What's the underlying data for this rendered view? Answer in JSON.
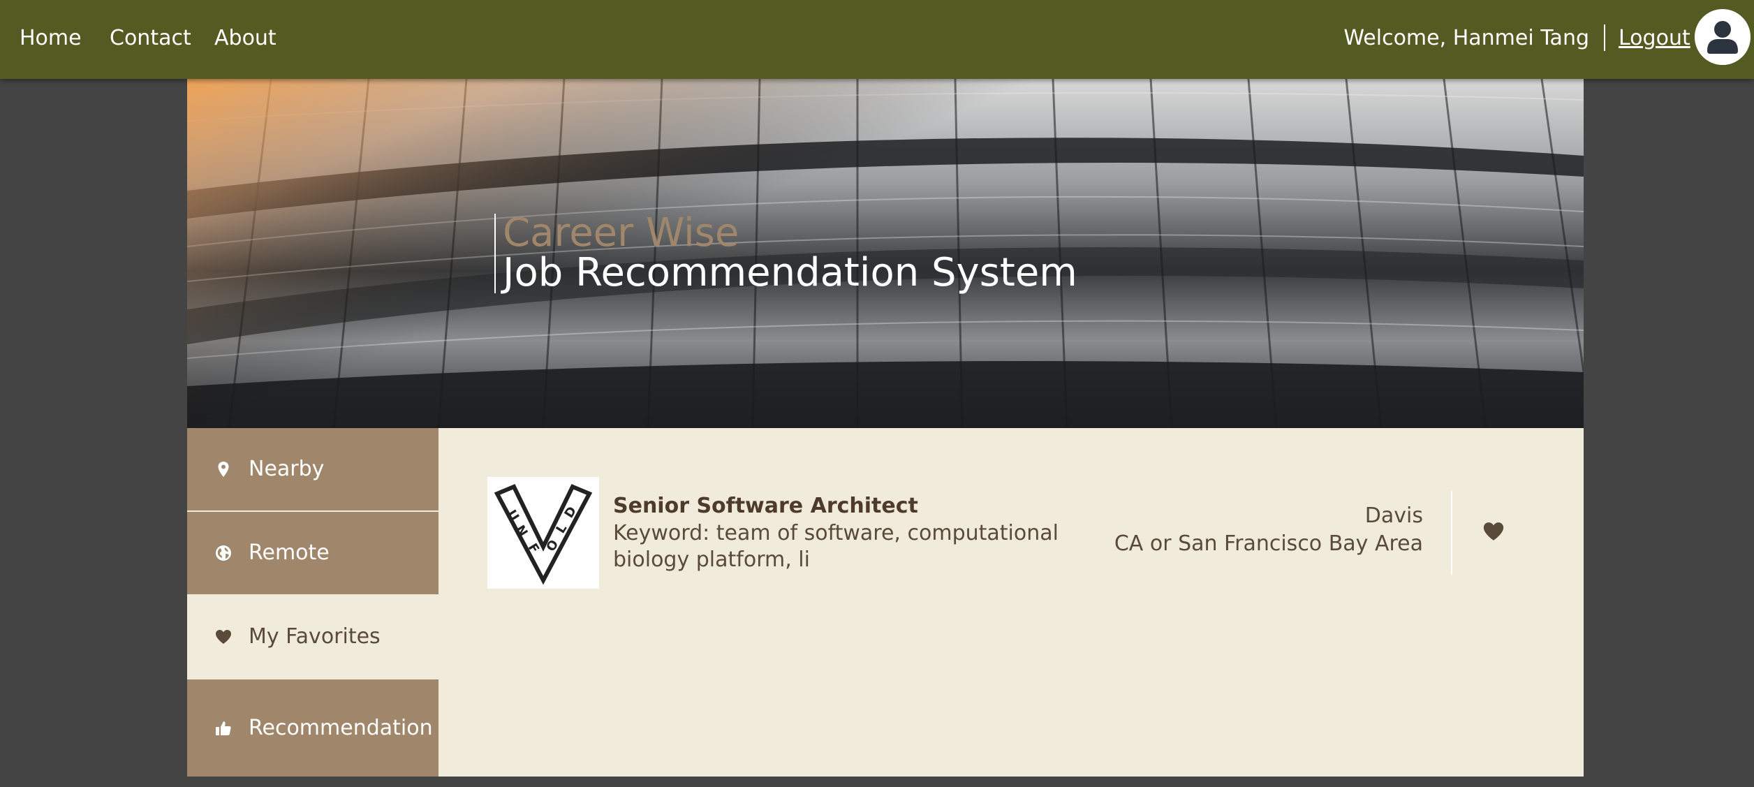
{
  "nav": {
    "home": "Home",
    "contact": "Contact",
    "about": "About",
    "welcome": "Welcome, Hanmei Tang",
    "logout": "Logout",
    "avatar_icon": "user-avatar-icon"
  },
  "hero": {
    "title": "Career Wise",
    "subtitle": "Job Recommendation System"
  },
  "sidebar": {
    "items": [
      {
        "label": "Nearby",
        "icon": "map-pin-icon",
        "active": false
      },
      {
        "label": "Remote",
        "icon": "globe-icon",
        "active": false
      },
      {
        "label": "My Favorites",
        "icon": "heart-icon",
        "active": true
      },
      {
        "label": "Recommendation",
        "icon": "thumbs-up-icon",
        "active": false
      }
    ]
  },
  "jobs": [
    {
      "title": "Senior Software Architect",
      "keyword": "Keyword: team of software, computational biology platform, li",
      "location_line1": "Davis",
      "location_line2": "CA or San Francisco Bay Area",
      "logo_text": "UNFOLD",
      "favorite_icon": "heart-icon"
    }
  ],
  "colors": {
    "nav_bg": "#535B22",
    "page_bg": "#444444",
    "panel_bg": "#F1EBDB",
    "sidebar_bg": "#A0866A",
    "accent_brown": "#A0866A",
    "text_brown": "#4E3B2C"
  }
}
